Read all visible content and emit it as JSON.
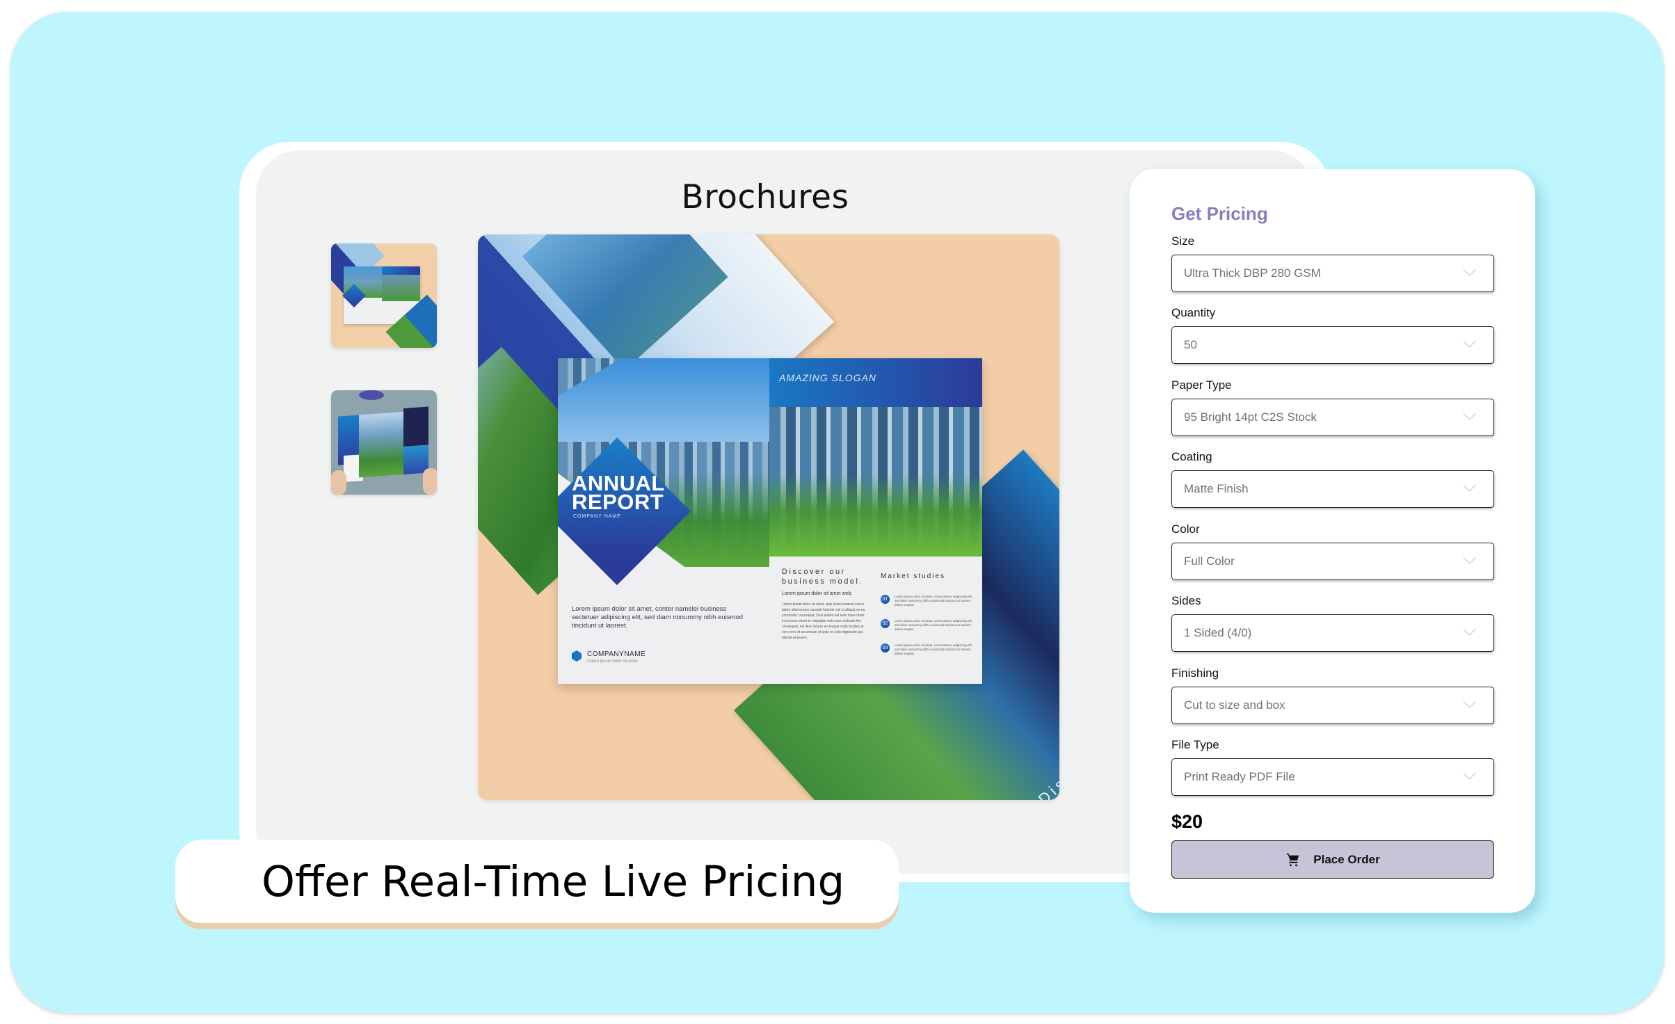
{
  "header": {
    "title": "Brochures"
  },
  "gallery": {
    "thumbnails": [
      {
        "alt": "Annual report brochure on peach background",
        "selected": true
      },
      {
        "alt": "Business headline brochure held in hands"
      }
    ],
    "main_image": {
      "alt": "Open annual report brochure mockup",
      "slogan": "AMAZING SLOGAN",
      "cover_title_line1": "ANNUAL",
      "cover_title_line2": "REPORT",
      "cover_subtitle": "COMPANY NAME",
      "cover_body": "Lorem ipsum dolor sit amet, conter namelei business sectetuer adipiscing elit, sed diam nonummy nibh euismod tincidunt ut laoreet.",
      "company_name": "COMPANYNAME",
      "company_tagline": "Lorem ipsum dolor sit amet",
      "discover_title": "Discover our business model.",
      "discover_sub": "Lorem ipsum dolor sit amet web.",
      "discover_body": "Lorem ipsum dolor sit amet, quis loveri nostrud exerci tation ullamcorper suscipit lobortis nisl ut aliquip ex ea commodo consequat. Duis autem vel eum iriure dolor in hennero drerit in vulputate velit esse molestie the consequat, vel illum dolore eu feugiat nulla facilisis at vero eros et accumsan et iusto os odio dignissim qui blandit praesent.",
      "market_title": "Market studies",
      "market_items": [
        {
          "num": "01",
          "text": "Lorem ipsum dolor sit amet, consectetuer adipiscing elit, sed diam nonummy nibh a euismod tincidunt ut laoreet dolore magna"
        },
        {
          "num": "02",
          "text": "Lorem ipsum dolor sit amet, consectetuer adipiscing elit, sed diam nonummy nibh a euismod tincidunt ut laoreet dolore magna"
        },
        {
          "num": "03",
          "text": "Lorem ipsum dolor sit amet, consectetuer adipiscing elit, sed diam nonummy nibh a euismod tincidunt ut laoreet dolore magna"
        }
      ],
      "fragment_text": "Discover our business model"
    }
  },
  "banner": {
    "text": "Offer Real-Time Live Pricing"
  },
  "pricing": {
    "title": "Get Pricing",
    "fields": [
      {
        "label": "Size",
        "value": "Ultra Thick DBP 280 GSM"
      },
      {
        "label": "Quantity",
        "value": "50"
      },
      {
        "label": "Paper Type",
        "value": "95 Bright 14pt C2S Stock"
      },
      {
        "label": "Coating",
        "value": "Matte Finish"
      },
      {
        "label": "Color",
        "value": "Full Color"
      },
      {
        "label": "Sides",
        "value": "1 Sided (4/0)"
      },
      {
        "label": "Finishing",
        "value": "Cut to size and box"
      },
      {
        "label": "File Type",
        "value": "Print Ready PDF File"
      }
    ],
    "price": "$20",
    "order_button": {
      "label": "Place Order",
      "icon": "cart-icon"
    }
  },
  "colors": {
    "background": "#bff6fd",
    "panel": "#f1f3f2",
    "accent": "#8a7bbf",
    "button": "#c6c5d8",
    "banner_shadow": "#e8cfb0",
    "image_backdrop": "#f2cda6"
  }
}
